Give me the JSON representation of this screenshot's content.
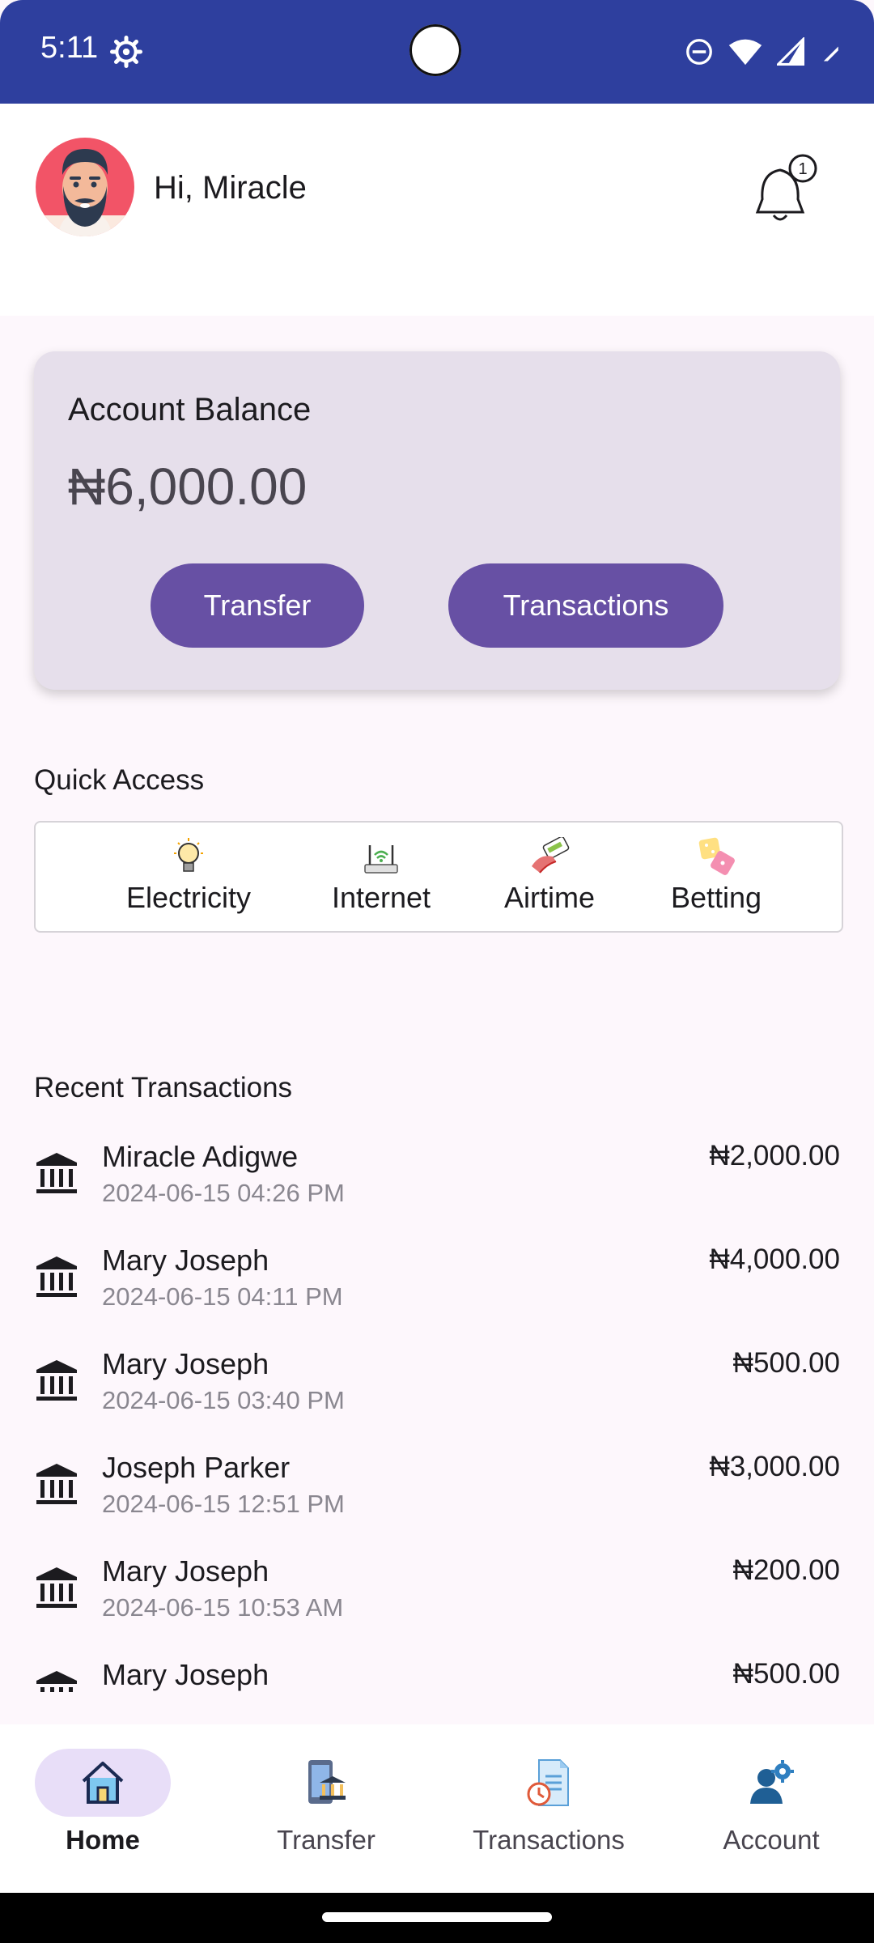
{
  "status_bar": {
    "time": "5:11"
  },
  "header": {
    "greeting": "Hi, Miracle",
    "notification_count": "1"
  },
  "balance_card": {
    "title": "Account Balance",
    "amount": "₦6,000.00",
    "transfer_label": "Transfer",
    "transactions_label": "Transactions"
  },
  "quick_access": {
    "title": "Quick Access",
    "items": [
      {
        "label": "Electricity",
        "icon": "lightbulb-icon"
      },
      {
        "label": "Internet",
        "icon": "router-icon"
      },
      {
        "label": "Airtime",
        "icon": "phone-recharge-icon"
      },
      {
        "label": "Betting",
        "icon": "dice-icon"
      }
    ]
  },
  "recent_transactions": {
    "title": "Recent Transactions",
    "items": [
      {
        "name": "Miracle Adigwe",
        "date": "2024-06-15 04:26 PM",
        "amount": "₦2,000.00"
      },
      {
        "name": "Mary Joseph",
        "date": "2024-06-15 04:11 PM",
        "amount": "₦4,000.00"
      },
      {
        "name": "Mary Joseph",
        "date": "2024-06-15 03:40 PM",
        "amount": "₦500.00"
      },
      {
        "name": "Joseph Parker",
        "date": "2024-06-15 12:51 PM",
        "amount": "₦3,000.00"
      },
      {
        "name": "Mary Joseph",
        "date": "2024-06-15 10:53 AM",
        "amount": "₦200.00"
      },
      {
        "name": "Mary Joseph",
        "date": "",
        "amount": "₦500.00"
      }
    ]
  },
  "bottom_nav": {
    "items": [
      {
        "label": "Home",
        "icon": "home-icon",
        "active": true
      },
      {
        "label": "Transfer",
        "icon": "bank-transfer-icon",
        "active": false
      },
      {
        "label": "Transactions",
        "icon": "history-icon",
        "active": false
      },
      {
        "label": "Account",
        "icon": "account-settings-icon",
        "active": false
      }
    ]
  },
  "colors": {
    "status_bar": "#2e3f9e",
    "primary": "#6750a4",
    "card": "#e6dfeb",
    "nav_indicator": "#e8def8",
    "background": "#fdf7fc"
  }
}
